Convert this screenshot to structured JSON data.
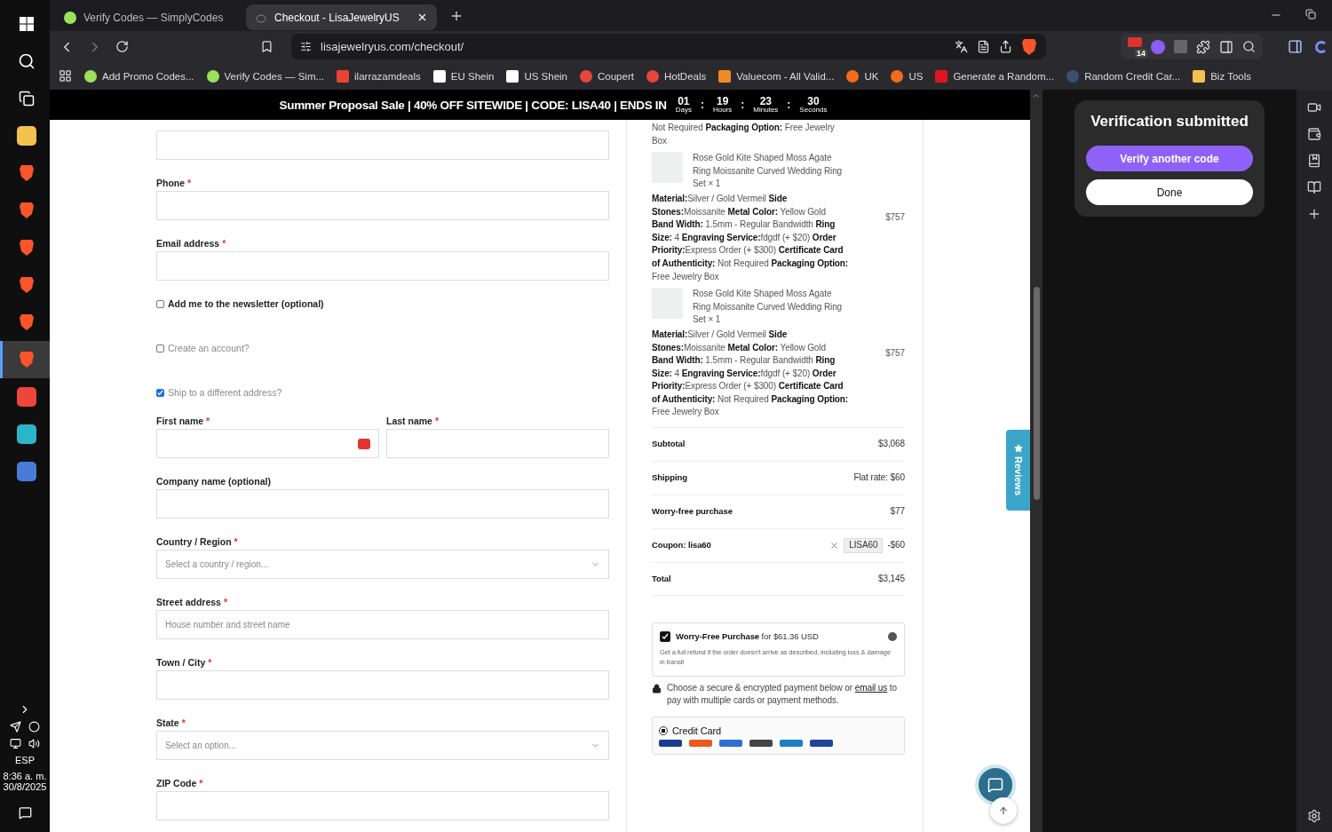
{
  "taskbar": {
    "apps": [
      {
        "kind": "folder",
        "selected": false
      },
      {
        "kind": "brave",
        "selected": false
      },
      {
        "kind": "brave",
        "selected": false
      },
      {
        "kind": "brave",
        "selected": false
      },
      {
        "kind": "brave",
        "selected": false
      },
      {
        "kind": "brave",
        "selected": false
      },
      {
        "kind": "brave",
        "selected": true
      },
      {
        "kind": "red-app",
        "selected": false
      },
      {
        "kind": "vpn",
        "selected": false
      },
      {
        "kind": "calculator",
        "selected": false
      }
    ],
    "language": "ESP",
    "time": "8:36 a. m.",
    "date": "30/8/2025"
  },
  "browser": {
    "tabs": [
      {
        "title": "Verify Codes — SimplyCodes",
        "selected": false
      },
      {
        "title": "Checkout - LisaJewelryUS",
        "selected": true
      }
    ],
    "url": "lisajewelryus.com/checkout/",
    "extension_badge": "14",
    "bookmarks": [
      {
        "label": "Add Promo Codes...",
        "kind": "green"
      },
      {
        "label": "Verify Codes — Sim...",
        "kind": "green"
      },
      {
        "label": "ilarrazamdeals",
        "kind": "mail"
      },
      {
        "label": "EU Shein",
        "kind": "letter-s"
      },
      {
        "label": "US Shein",
        "kind": "letter-s"
      },
      {
        "label": "Coupert",
        "kind": "red"
      },
      {
        "label": "HotDeals",
        "kind": "red"
      },
      {
        "label": "Valuecom - All Valid...",
        "kind": "diamond"
      },
      {
        "label": "UK",
        "kind": "letter-r"
      },
      {
        "label": "US",
        "kind": "letter-r"
      },
      {
        "label": "Generate a Random...",
        "kind": "letter-f"
      },
      {
        "label": "Random Credit Car...",
        "kind": "gear"
      },
      {
        "label": "Biz Tools",
        "kind": "folder"
      }
    ]
  },
  "banner": {
    "text": "Summer Proposal Sale | 40% OFF SITEWIDE | CODE: LISA40 | ENDS IN",
    "separator": ":",
    "countdown": [
      {
        "value": "01",
        "unit": "Days"
      },
      {
        "value": "19",
        "unit": "Hours"
      },
      {
        "value": "23",
        "unit": "Minutes"
      },
      {
        "value": "30",
        "unit": "Seconds"
      }
    ]
  },
  "form": [
    {
      "kind": "input"
    },
    {
      "kind": "input",
      "label": "Phone",
      "mark": "*"
    },
    {
      "kind": "input",
      "label": "Email address",
      "mark": "*"
    },
    {
      "kind": "checkbox",
      "label": "Add me to the newsletter (optional)",
      "checked": false,
      "strong": true
    },
    {
      "kind": "checkbox",
      "label": "Create an account?",
      "checked": false,
      "strong": false
    },
    {
      "kind": "checkbox",
      "label": "Ship to a different address?",
      "checked": true,
      "strong": false
    },
    {
      "kind": "pair",
      "fields": [
        {
          "label": "First name",
          "mark": "*",
          "autofill": true
        },
        {
          "label": "Last name",
          "mark": "*",
          "autofill": false
        }
      ]
    },
    {
      "kind": "input",
      "label": "Company name (optional)"
    },
    {
      "kind": "select",
      "label": "Country / Region",
      "mark": "*",
      "placeholder": "Select a country / region..."
    },
    {
      "kind": "input",
      "label": "Street address",
      "mark": "*",
      "placeholder": "House number and street name"
    },
    {
      "kind": "input",
      "label": "Town / City",
      "mark": "*"
    },
    {
      "kind": "select",
      "label": "State",
      "mark": "*",
      "placeholder": "Select an option..."
    },
    {
      "kind": "input",
      "label": "ZIP Code",
      "mark": "*"
    }
  ],
  "order": {
    "items": [
      {
        "details": "Not Required **Packaging Option:** Free Jewelry Box"
      },
      {
        "name": "Rose Gold Kite Shaped Moss Agate Ring Moissanite Curved Wedding Ring Set",
        "qty": "× 1",
        "price": "$757",
        "details": "**Material:**Silver / Gold Vermeil **Side Stones:**Moissanite **Metal Color:** Yellow Gold **Band Width:** 1.5mm - Regular Bandwidth **Ring Size:** 4 **Engraving Service:**fdgdf (+ $20) **Order Priority:**Express Order (+ $300) **Certificate Card of Authenticity:** Not Required **Packaging Option:** Free Jewelry Box"
      },
      {
        "name": "Rose Gold Kite Shaped Moss Agate Ring Moissanite Curved Wedding Ring Set",
        "qty": "× 1",
        "price": "$757",
        "details": "**Material:**Silver / Gold Vermeil **Side Stones:**Moissanite **Metal Color:** Yellow Gold **Band Width:** 1.5mm - Regular Bandwidth **Ring Size:** 4 **Engraving Service:**fdgdf (+ $20) **Order Priority:**Express Order (+ $300) **Certificate Card of Authenticity:** Not Required **Packaging Option:** Free Jewelry Box"
      }
    ],
    "summary": [
      {
        "kind": "plain",
        "label": "Subtotal",
        "value": "$3,068"
      },
      {
        "kind": "plain",
        "label": "Shipping",
        "value": "Flat rate: $60"
      },
      {
        "kind": "plain",
        "label": "Worry-free purchase",
        "value": "$77"
      },
      {
        "kind": "coupon",
        "label": "Coupon: lisa60",
        "code": "LISA60",
        "value": "-$60"
      },
      {
        "kind": "plain",
        "label": "Total",
        "value": "$3,145"
      }
    ],
    "protection": {
      "checked": true,
      "title": "Worry-Free Purchase",
      "price": "for $61.36 USD",
      "description": "Get a full refund if the order doesn't arrive as described, including loss & damage in transit"
    },
    "secure_note": {
      "before": "Choose a secure & encrypted payment below or ",
      "link": "email us",
      "after": " to pay with multiple cards or payment methods."
    },
    "payment_methods": [
      {
        "label": "Credit Card",
        "selected": true
      }
    ]
  },
  "reviews_tab": "Reviews",
  "side_panel": {
    "title": "Verification submitted",
    "buttons": [
      {
        "label": "Verify another code",
        "kind": "primary"
      },
      {
        "label": "Done",
        "kind": "secondary"
      }
    ]
  }
}
